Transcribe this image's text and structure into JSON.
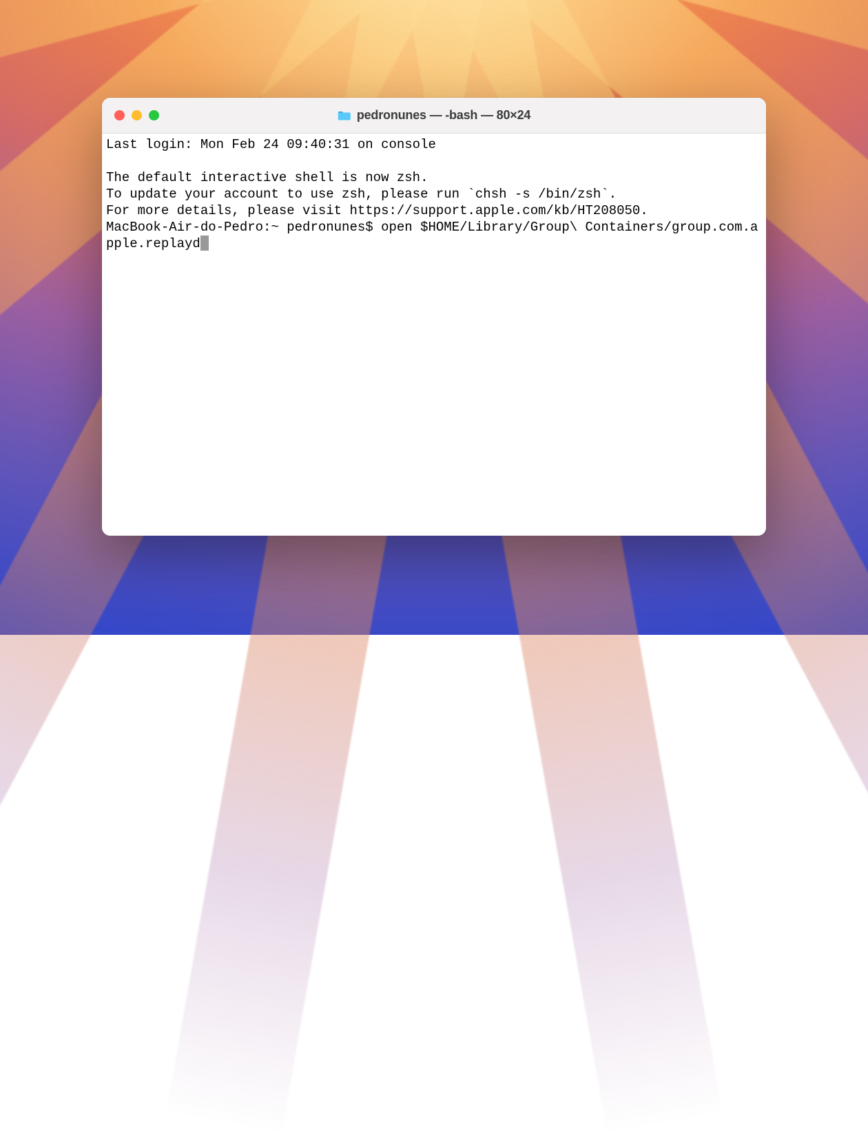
{
  "window": {
    "title": "pedronunes — -bash — 80×24"
  },
  "terminal": {
    "lines": [
      "Last login: Mon Feb 24 09:40:31 on console",
      "",
      "The default interactive shell is now zsh.",
      "To update your account to use zsh, please run `chsh -s /bin/zsh`.",
      "For more details, please visit https://support.apple.com/kb/HT208050."
    ],
    "prompt": "MacBook-Air-do-Pedro:~ pedronunes$ ",
    "command": "open $HOME/Library/Group\\ Containers/group.com.apple.replayd"
  }
}
